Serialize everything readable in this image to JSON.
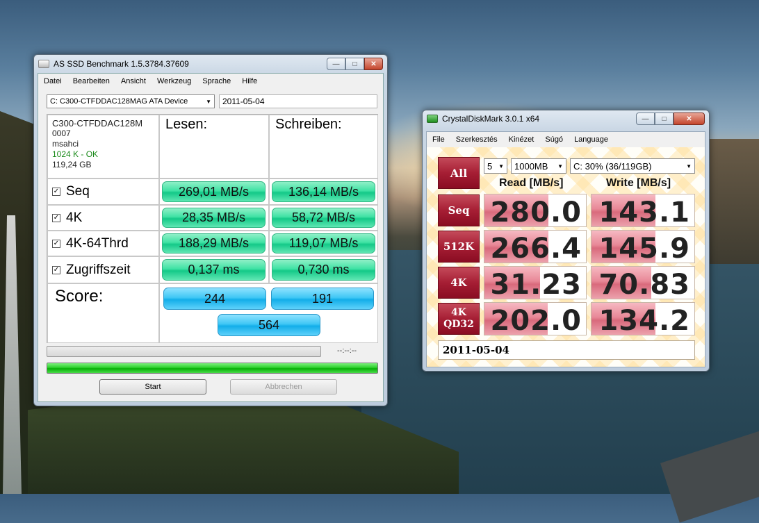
{
  "asssd": {
    "title": "AS SSD Benchmark 1.5.3784.37609",
    "menu": [
      "Datei",
      "Bearbeiten",
      "Ansicht",
      "Werkzeug",
      "Sprache",
      "Hilfe"
    ],
    "drive": "C: C300-CTFDDAC128MAG ATA Device",
    "date": "2011-05-04",
    "info": {
      "model": "C300-CTFDDAC128M",
      "firmware": "0007",
      "driver": "msahci",
      "alignment": "1024 K - OK",
      "size": "119,24 GB"
    },
    "read_header": "Lesen:",
    "write_header": "Schreiben:",
    "rows": [
      {
        "label": "Seq",
        "checked": true,
        "read": "269,01 MB/s",
        "write": "136,14 MB/s"
      },
      {
        "label": "4K",
        "checked": true,
        "read": "28,35 MB/s",
        "write": "58,72 MB/s"
      },
      {
        "label": "4K-64Thrd",
        "checked": true,
        "read": "188,29 MB/s",
        "write": "119,07 MB/s"
      },
      {
        "label": "Zugriffszeit",
        "checked": true,
        "read": "0,137 ms",
        "write": "0,730 ms"
      }
    ],
    "score_label": "Score:",
    "score_read": "244",
    "score_write": "191",
    "score_total": "564",
    "timer": "--:--:--",
    "progress_main": 1.0,
    "start_label": "Start",
    "abort_label": "Abbrechen"
  },
  "cdm": {
    "title": "CrystalDiskMark 3.0.1 x64",
    "menu": [
      "File",
      "Szerkesztés",
      "Kinézet",
      "Súgó",
      "Language"
    ],
    "all_label": "All",
    "runs": "5",
    "size": "1000MB",
    "drive": "C: 30% (36/119GB)",
    "read_header": "Read [MB/s]",
    "write_header": "Write [MB/s]",
    "rows": [
      {
        "label": "Seq",
        "read": "280.0",
        "write": "143.1",
        "read_fill": 0.63,
        "write_fill": 0.62
      },
      {
        "label": "512K",
        "read": "266.4",
        "write": "145.9",
        "read_fill": 0.63,
        "write_fill": 0.62
      },
      {
        "label": "4K",
        "read": "31.23",
        "write": "70.83",
        "read_fill": 0.55,
        "write_fill": 0.58
      },
      {
        "label": "4K QD32",
        "read": "202.0",
        "write": "134.2",
        "read_fill": 0.62,
        "write_fill": 0.62
      }
    ],
    "comment": "2011-05-04"
  },
  "colors": {
    "green_pill": "#3fe2a4",
    "blue_pill": "#3fc7f5",
    "cdm_red": "#a61e34",
    "cdm_fill": "#e88897",
    "progress_green": "#2bd02b"
  }
}
